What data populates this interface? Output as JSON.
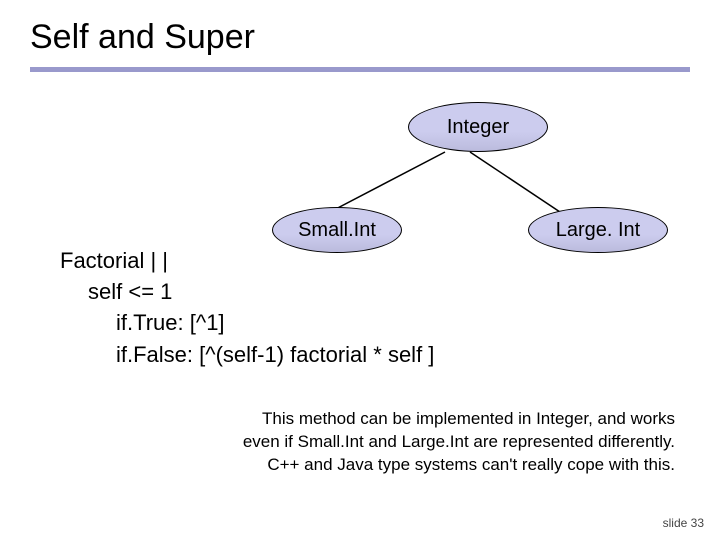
{
  "slide": {
    "title": "Self and Super",
    "number_label": "slide 33"
  },
  "diagram": {
    "root": "Integer",
    "left": "Small.Int",
    "right": "Large. Int"
  },
  "code": {
    "l1": "Factorial | |",
    "l2": "self <= 1",
    "l3": "if.True: [^1]",
    "l4": "if.False: [^(self-1) factorial * self ]"
  },
  "note": {
    "l1": "This method can be implemented in Integer, and works",
    "l2": "even if Small.Int and Large.Int are represented differently.",
    "l3": "C++ and Java type systems can't really cope with this."
  }
}
